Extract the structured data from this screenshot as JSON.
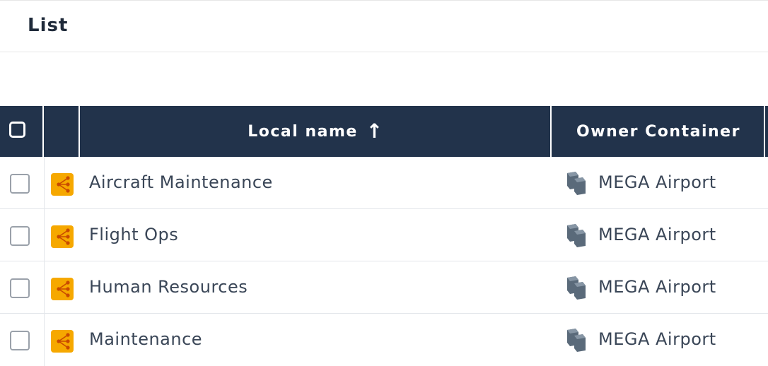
{
  "panel": {
    "title": "List"
  },
  "table": {
    "columns": {
      "local_name": "Local name",
      "local_name_sort": "↑",
      "owner_container": "Owner Container"
    },
    "rows": [
      {
        "name": "Aircraft Maintenance",
        "owner": "MEGA Airport",
        "icon": "org-unit-icon",
        "owner_icon": "container-icon"
      },
      {
        "name": "Flight Ops",
        "owner": "MEGA Airport",
        "icon": "org-unit-icon",
        "owner_icon": "container-icon"
      },
      {
        "name": "Human Resources",
        "owner": "MEGA Airport",
        "icon": "org-unit-icon",
        "owner_icon": "container-icon"
      },
      {
        "name": "Maintenance",
        "owner": "MEGA Airport",
        "icon": "org-unit-icon",
        "owner_icon": "container-icon"
      }
    ]
  },
  "colors": {
    "header_bg": "#22334b",
    "org_icon": "#f6a800"
  }
}
